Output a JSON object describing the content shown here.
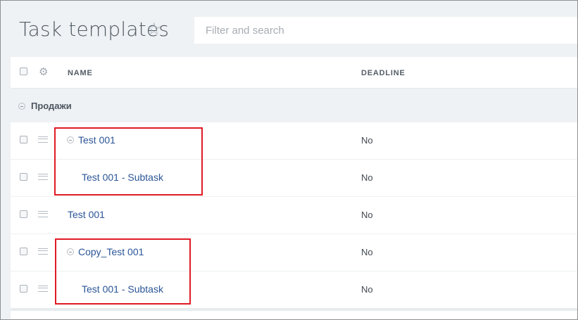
{
  "header": {
    "title": "Task templates",
    "search_placeholder": "Filter and search"
  },
  "table": {
    "columns": {
      "name": "NAME",
      "deadline": "DEADLINE"
    },
    "group": {
      "label": "Продажи"
    },
    "rows": [
      {
        "name": "Test 001",
        "deadline": "No",
        "collapsible": true,
        "level": 0
      },
      {
        "name": "Test 001 - Subtask",
        "deadline": "No",
        "collapsible": false,
        "level": 1
      },
      {
        "name": "Test 001",
        "deadline": "No",
        "collapsible": false,
        "level": 0
      },
      {
        "name": "Copy_Test 001",
        "deadline": "No",
        "collapsible": true,
        "level": 0
      },
      {
        "name": "Test 001 - Subtask",
        "deadline": "No",
        "collapsible": false,
        "level": 1
      }
    ]
  },
  "colors": {
    "background": "#eef2f4",
    "link": "#2b5597",
    "highlight_box": "#e01b24"
  }
}
